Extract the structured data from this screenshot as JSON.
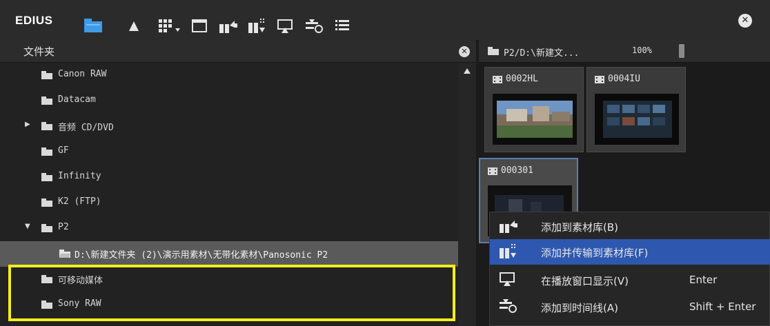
{
  "app": {
    "brand": "EDIUS"
  },
  "toolbar": {
    "icons": [
      "folder-icon",
      "upload-icon",
      "view-mode-icon",
      "window-icon",
      "add-to-bin-icon",
      "add-transfer-icon",
      "display-icon",
      "add-timeline-icon",
      "list-icon"
    ],
    "close_symbol": "✕"
  },
  "folder_panel": {
    "title": "文件夹",
    "close_symbol": "✕",
    "items": [
      {
        "label": "Canon RAW",
        "expander": ""
      },
      {
        "label": "Datacam",
        "expander": ""
      },
      {
        "label": "音频 CD/DVD",
        "expander": "▶"
      },
      {
        "label": "GF",
        "expander": ""
      },
      {
        "label": "Infinity",
        "expander": ""
      },
      {
        "label": "K2 (FTP)",
        "expander": ""
      },
      {
        "label": "P2",
        "expander": "▼"
      },
      {
        "label": "D:\\新建文件夹 (2)\\演示用素材\\无带化素材\\Panosonic  P2",
        "expander": ""
      },
      {
        "label": "可移动媒体",
        "expander": ""
      },
      {
        "label": "Sony RAW",
        "expander": ""
      }
    ]
  },
  "clip_panel": {
    "path": "P2/D:\\新建文...",
    "zoom": "100%",
    "clips": [
      {
        "name": "0002HL"
      },
      {
        "name": "0004IU"
      },
      {
        "name": "000301"
      }
    ]
  },
  "context_menu": {
    "items": [
      {
        "label": "添加到素材库(B)",
        "shortcut": "",
        "icon": "add-to-bin-icon"
      },
      {
        "label": "添加并传输到素材库(F)",
        "shortcut": "",
        "icon": "add-transfer-icon"
      },
      {
        "label": "在播放窗口显示(V)",
        "shortcut": "Enter",
        "icon": "display-icon"
      },
      {
        "label": "添加到时间线(A)",
        "shortcut": "Shift + Enter",
        "icon": "add-timeline-icon"
      }
    ]
  },
  "colors": {
    "accent_blue": "#2e58b0",
    "folder_blue": "#3f9be6",
    "highlight_yellow": "#f2ee1c"
  }
}
